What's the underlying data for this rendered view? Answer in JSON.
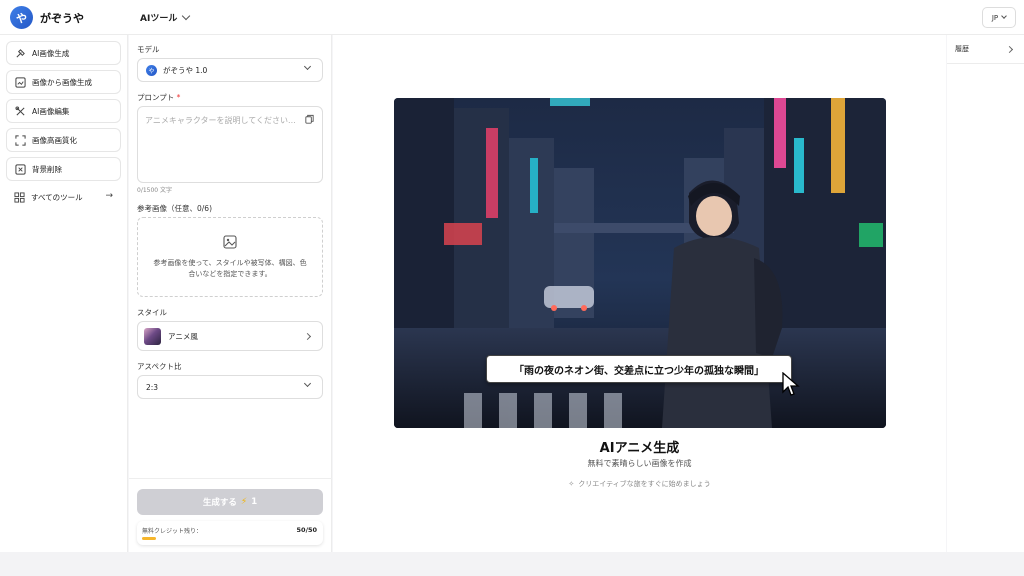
{
  "header": {
    "logo_text": "や",
    "brand": "がぞうや",
    "tool_switch_label": "AIツール",
    "lang_label": "JP"
  },
  "sidebar": {
    "items": [
      {
        "label": "AI画像生成",
        "icon": "brush-icon"
      },
      {
        "label": "画像から画像生成",
        "icon": "image-swap-icon"
      },
      {
        "label": "AI画像編集",
        "icon": "edit-tools-icon"
      },
      {
        "label": "画像高画質化",
        "icon": "upscale-icon"
      },
      {
        "label": "背景削除",
        "icon": "background-remove-icon"
      }
    ],
    "all_tools_label": "すべてのツール"
  },
  "panel": {
    "model_label": "モデル",
    "model_value": "がぞうや 1.0",
    "prompt_label": "プロンプト",
    "prompt_required": "*",
    "prompt_placeholder": "アニメキャラクターを説明してください...",
    "prompt_counter": "0/1500 文字",
    "reference_label": "参考画像（任意、0/6)",
    "reference_hint": "参考画像を使って、スタイルや被写体、構図、色合いなどを指定できます。",
    "style_label": "スタイル",
    "style_value": "アニメ風",
    "aspect_label": "アスペクト比",
    "aspect_value": "2:3",
    "generate_label": "生成する",
    "generate_cost": "1",
    "credit_label": "無料クレジット残り：",
    "credit_value": "50/50",
    "credit_fraction": 0.08
  },
  "main": {
    "caption": "「雨の夜のネオン街、交差点に立つ少年の孤独な瞬間」",
    "title": "AIアニメ生成",
    "subtitle": "無料で素晴らしい画像を作成",
    "hint": "クリエイティブな旅をすぐに始めましょう"
  },
  "history": {
    "label": "履歴"
  },
  "colors": {
    "accent": "#2f6fe0",
    "credit_bar": "#f6b62c",
    "generate_disabled": "#cfcfd4"
  }
}
